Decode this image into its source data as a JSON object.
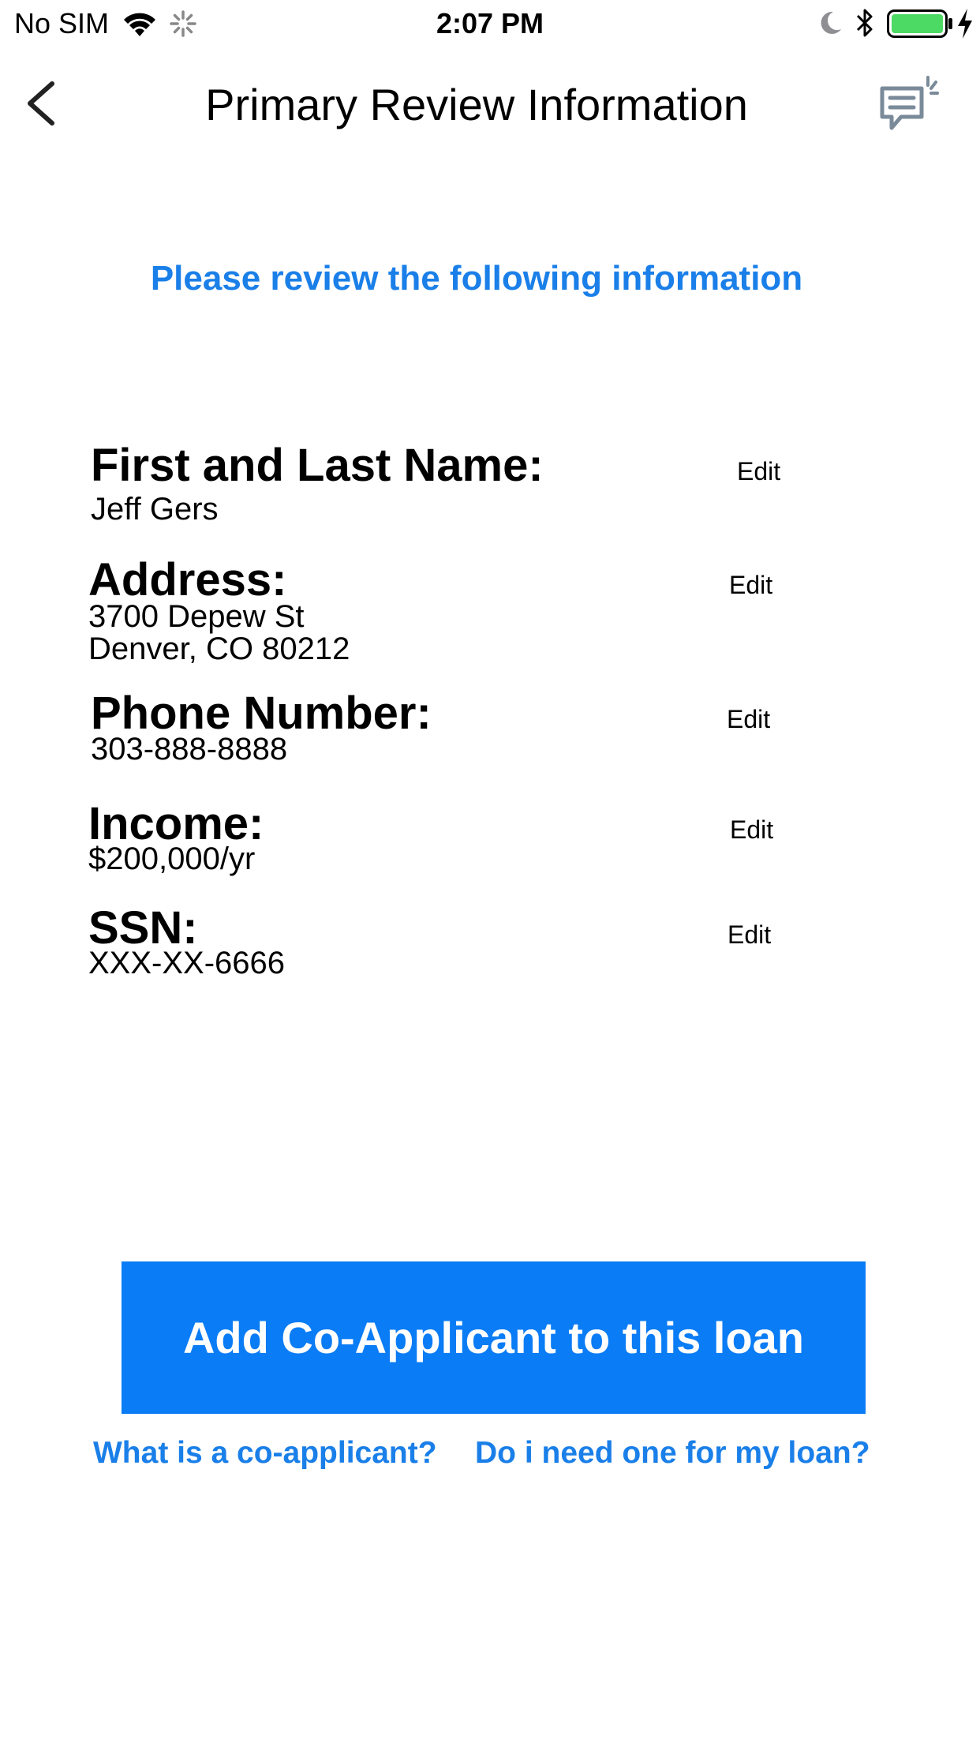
{
  "status_bar": {
    "carrier": "No SIM",
    "time": "2:07 PM",
    "battery_color": "#4cd964"
  },
  "nav": {
    "title": "Primary Review Information",
    "back_icon": "chevron-left-icon",
    "chat_icon": "chat-bubble-icon"
  },
  "subtitle": "Please review the following information",
  "fields": [
    {
      "label": "First and Last Name:",
      "value_lines": [
        "Jeff Gers"
      ],
      "edit_label": "Edit"
    },
    {
      "label": "Address:",
      "value_lines": [
        "3700 Depew St",
        "Denver, CO 80212"
      ],
      "edit_label": "Edit"
    },
    {
      "label": "Phone Number:",
      "value_lines": [
        "303-888-8888"
      ],
      "edit_label": "Edit"
    },
    {
      "label": "Income:",
      "value_lines": [
        "$200,000/yr"
      ],
      "edit_label": "Edit"
    },
    {
      "label": "SSN:",
      "value_lines": [
        "XXX-XX-6666"
      ],
      "edit_label": "Edit"
    }
  ],
  "primary_button": {
    "label": "Add Co-Applicant to this loan",
    "color": "#0a7cf5"
  },
  "help_links": {
    "what_is": "What is a co-applicant?",
    "do_i_need": "Do i need one for my loan?"
  },
  "accent_color": "#1a7fe8"
}
